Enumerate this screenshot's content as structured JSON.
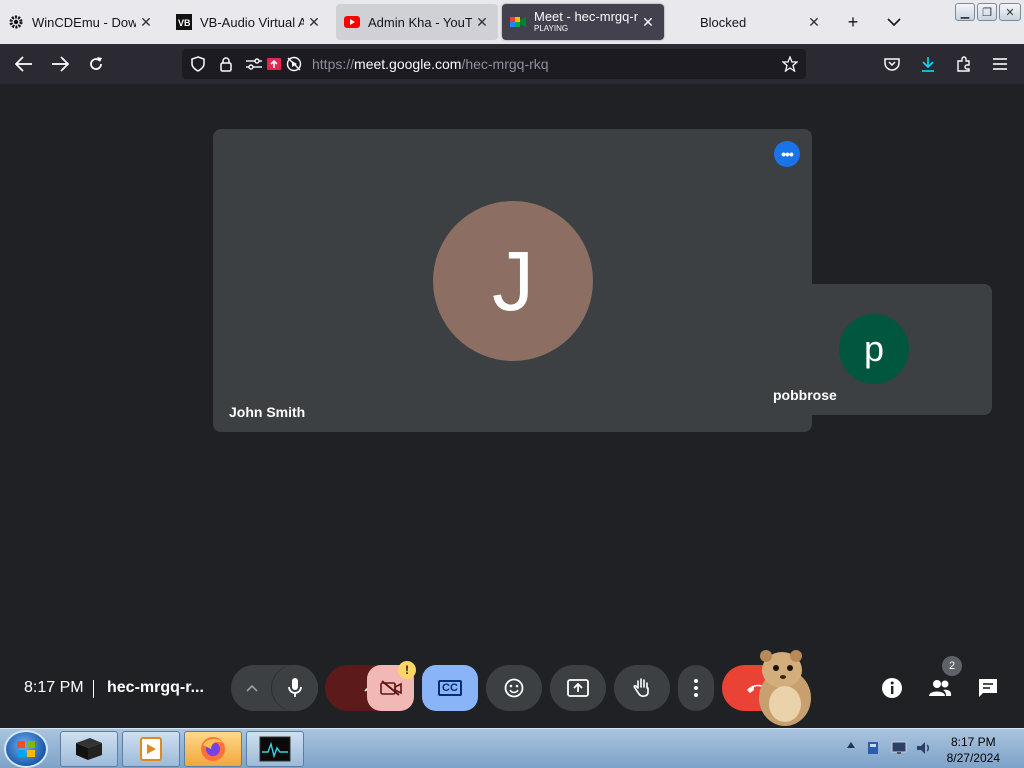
{
  "browser": {
    "tabs": [
      {
        "title": "WinCDEmu - Downl",
        "icon": "gear-icon"
      },
      {
        "title": "VB-Audio Virtual App",
        "icon": "vb-icon"
      },
      {
        "title": "Admin Kha - YouTu",
        "icon": "youtube-icon"
      },
      {
        "title": "Meet - hec-mrgq-rkq",
        "subtitle": "PLAYING",
        "icon": "meet-icon"
      },
      {
        "title": "Blocked",
        "icon": ""
      }
    ],
    "new_tab": "+",
    "url": {
      "prefix": "https://",
      "host": "meet.google.com",
      "path": "/hec-mrgq-rkq"
    }
  },
  "meet": {
    "participants": [
      {
        "name": "John Smith",
        "initial": "J",
        "color": "#8d6e63"
      },
      {
        "name": "pobbrose",
        "initial": "p",
        "color": "#00563f"
      }
    ],
    "time": "8:17 PM",
    "meeting_code": "hec-mrgq-r...",
    "people_count": "2",
    "cc_label": "CC",
    "camera_warning": "!"
  },
  "taskbar": {
    "time": "8:17 PM",
    "date": "8/27/2024"
  }
}
